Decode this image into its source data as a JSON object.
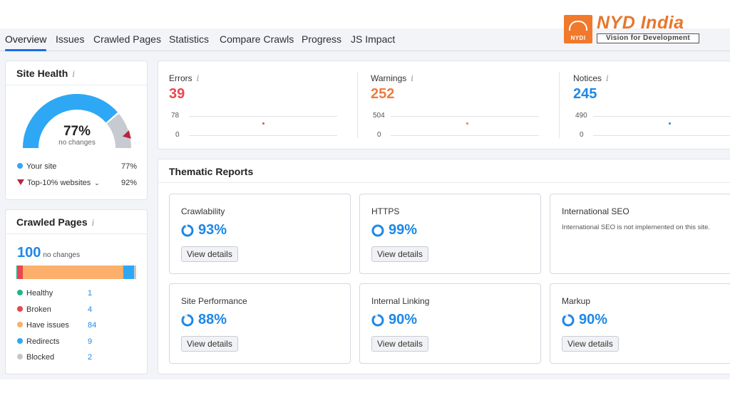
{
  "logo": {
    "mark_text": "NYDI",
    "title": "NYD India",
    "tagline": "Vision for Development"
  },
  "nav": {
    "tabs": [
      {
        "label": "Overview",
        "active": true
      },
      {
        "label": "Issues"
      },
      {
        "label": "Crawled Pages"
      },
      {
        "label": "Statistics"
      },
      {
        "label": "Compare Crawls"
      },
      {
        "label": "Progress"
      },
      {
        "label": "JS Impact"
      }
    ]
  },
  "site_health": {
    "title": "Site Health",
    "info_icon": "i",
    "value": "77%",
    "percent": 77,
    "benchmark_percent": 92,
    "subtitle": "no changes",
    "your_site_label": "Your site",
    "your_site_value": "77%",
    "top_label": "Top-10% websites",
    "top_value": "92%",
    "colors": {
      "fill": "#2ea8f5",
      "track": "#c8cad1",
      "marker": "#b8243c"
    }
  },
  "crawled_pages": {
    "title": "Crawled Pages",
    "info_icon": "i",
    "total": "100",
    "total_sub": "no changes",
    "rows": [
      {
        "label": "Healthy",
        "value": "1",
        "count": 1,
        "color": "#1fb58a"
      },
      {
        "label": "Broken",
        "value": "4",
        "count": 4,
        "color": "#e8474f"
      },
      {
        "label": "Have issues",
        "value": "84",
        "count": 84,
        "color": "#fbaf6b"
      },
      {
        "label": "Redirects",
        "value": "9",
        "count": 9,
        "color": "#2ea8f5"
      },
      {
        "label": "Blocked",
        "value": "2",
        "count": 2,
        "color": "#c4c6cc"
      }
    ]
  },
  "metrics": [
    {
      "label": "Errors",
      "value": "39",
      "color": "#e8474f",
      "axis_top": "78",
      "axis_bottom": "0"
    },
    {
      "label": "Warnings",
      "value": "252",
      "color": "#f07a3e",
      "axis_top": "504",
      "axis_bottom": "0"
    },
    {
      "label": "Notices",
      "value": "245",
      "color": "#1c88e8",
      "axis_top": "490",
      "axis_bottom": "0"
    }
  ],
  "thematic": {
    "title": "Thematic Reports",
    "tiles": [
      {
        "title": "Crawlability",
        "score": "93%",
        "percent": 93,
        "button": "View details"
      },
      {
        "title": "HTTPS",
        "score": "99%",
        "percent": 99,
        "button": "View details"
      },
      {
        "title": "International SEO",
        "description": "International SEO is not implemented on this site."
      },
      {
        "title": "Site Performance",
        "score": "88%",
        "percent": 88,
        "button": "View details"
      },
      {
        "title": "Internal Linking",
        "score": "90%",
        "percent": 90,
        "button": "View details"
      },
      {
        "title": "Markup",
        "score": "90%",
        "percent": 90,
        "button": "View details"
      }
    ]
  }
}
